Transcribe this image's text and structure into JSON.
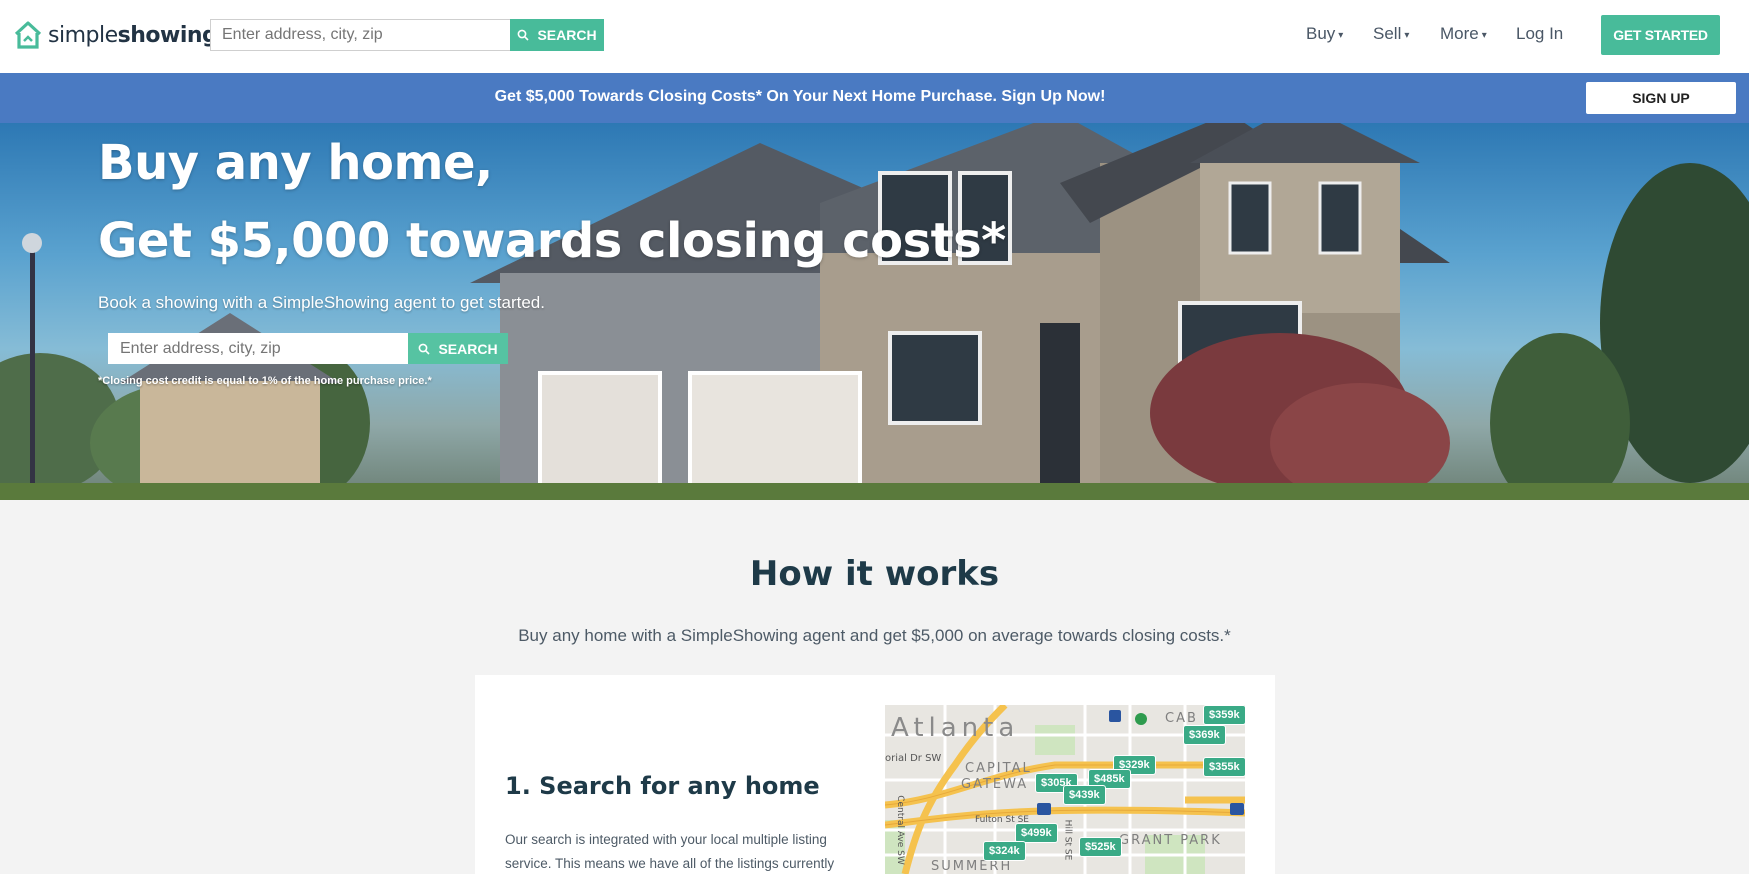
{
  "brand": {
    "name_light": "simple",
    "name_bold": "showing",
    "accent": "#48bb9a"
  },
  "header": {
    "search_placeholder": "Enter address, city, zip",
    "search_button": "SEARCH",
    "nav": [
      {
        "label": "Buy",
        "has_dropdown": true
      },
      {
        "label": "Sell",
        "has_dropdown": true
      },
      {
        "label": "More",
        "has_dropdown": true
      },
      {
        "label": "Log In",
        "has_dropdown": false
      }
    ],
    "cta": "GET STARTED"
  },
  "promo": {
    "text": "Get $5,000 Towards Closing Costs* On Your Next Home Purchase. Sign Up Now!",
    "button": "SIGN UP",
    "bg_color": "#4a7ac2"
  },
  "hero": {
    "title_line1": "Buy any home,",
    "title_line2": "Get $5,000 towards closing costs*",
    "subtitle": "Book a showing with a SimpleShowing agent to get started.",
    "search_placeholder": "Enter address, city, zip",
    "search_button": "SEARCH",
    "note": "*Closing cost credit is equal to 1% of the home purchase price.*"
  },
  "how_it_works": {
    "title": "How it works",
    "subtitle": "Buy any home with a SimpleShowing agent and get $5,000 on average towards closing costs.*",
    "step": {
      "title": "1. Search for any home",
      "text": "Our search is integrated with your local multiple listing service. This means we have all of the listings currently"
    },
    "map": {
      "city_label": "Atlanta",
      "neighborhoods": [
        "CAPITAL",
        "GATEWA",
        "GRANT PARK",
        "CAB",
        "SUMMERH"
      ],
      "streets": [
        "orial Dr SW",
        "Central Ave SW",
        "Fulton St SE",
        "Hill St SE"
      ],
      "price_pins": [
        "$359k",
        "$369k",
        "$355k",
        "$329k",
        "$305k",
        "$485k",
        "$439k",
        "$499k",
        "$525k",
        "$324k"
      ]
    }
  }
}
